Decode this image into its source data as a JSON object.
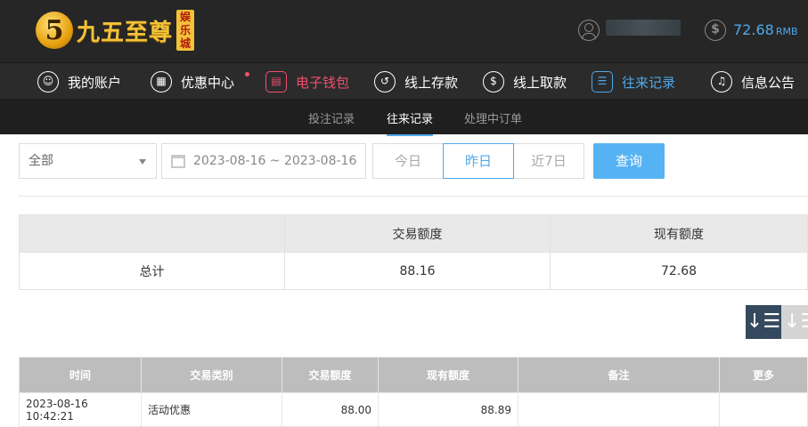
{
  "header": {
    "logo_mark": "5",
    "logo_text": "九五至尊",
    "logo_sub": "娱乐城",
    "balance": "72.68",
    "currency": "RMB"
  },
  "nav": {
    "items": [
      {
        "label": "我的账户",
        "icon": "user-circle-icon"
      },
      {
        "label": "优惠中心",
        "icon": "gift-icon"
      },
      {
        "label": "电子钱包",
        "icon": "wallet-icon"
      },
      {
        "label": "线上存款",
        "icon": "deposit-icon"
      },
      {
        "label": "线上取款",
        "icon": "withdraw-icon"
      },
      {
        "label": "往来记录",
        "icon": "record-icon"
      },
      {
        "label": "信息公告",
        "icon": "bell-icon"
      }
    ]
  },
  "subnav": {
    "tabs": [
      "投注记录",
      "往来记录",
      "处理中订单"
    ]
  },
  "filter": {
    "type_value": "全部",
    "date_range": "2023-08-16 ~ 2023-08-16",
    "quick_today": "今日",
    "quick_yesterday": "昨日",
    "quick_7days": "近7日",
    "query_label": "查询"
  },
  "summary": {
    "headers": [
      "",
      "交易额度",
      "现有额度"
    ],
    "row_label": "总计",
    "trade_amount": "88.16",
    "current_amount": "72.68"
  },
  "records": {
    "headers": [
      "时间",
      "交易类别",
      "交易额度",
      "现有额度",
      "备注",
      "更多"
    ],
    "rows": [
      {
        "time": "2023-08-16 10:42:21",
        "type": "活动优惠",
        "trade": "88.00",
        "current": "88.89",
        "note": "",
        "more": ""
      }
    ]
  },
  "colors": {
    "accent": "#4fa8ea",
    "header_bg": "#262626",
    "active_red": "#f0506e"
  }
}
